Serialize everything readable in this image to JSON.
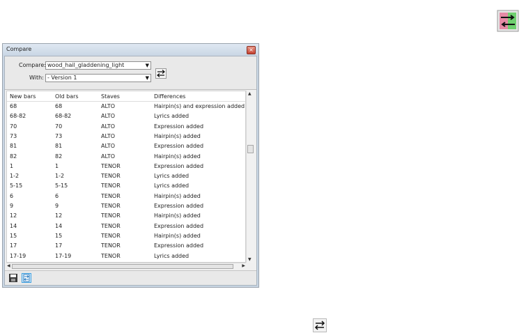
{
  "dialog": {
    "title": "Compare",
    "compare_label": "Compare:",
    "compare_value": "wood_hail_gladdening_light",
    "with_label": "With:",
    "with_value": "- Version 1"
  },
  "table": {
    "columns": [
      "New bars",
      "Old bars",
      "Staves",
      "Differences"
    ],
    "rows": [
      {
        "new": "68",
        "old": "68",
        "stave": "ALTO",
        "diff": "Hairpin(s) and expression added"
      },
      {
        "new": "68-82",
        "old": "68-82",
        "stave": "ALTO",
        "diff": "Lyrics added"
      },
      {
        "new": "70",
        "old": "70",
        "stave": "ALTO",
        "diff": "Expression added"
      },
      {
        "new": "73",
        "old": "73",
        "stave": "ALTO",
        "diff": "Hairpin(s) added"
      },
      {
        "new": "81",
        "old": "81",
        "stave": "ALTO",
        "diff": "Expression added"
      },
      {
        "new": "82",
        "old": "82",
        "stave": "ALTO",
        "diff": "Hairpin(s) added"
      },
      {
        "new": "1",
        "old": "1",
        "stave": "TENOR",
        "diff": "Expression added"
      },
      {
        "new": "1-2",
        "old": "1-2",
        "stave": "TENOR",
        "diff": "Lyrics added"
      },
      {
        "new": "5-15",
        "old": "5-15",
        "stave": "TENOR",
        "diff": "Lyrics added"
      },
      {
        "new": "6",
        "old": "6",
        "stave": "TENOR",
        "diff": "Hairpin(s) added"
      },
      {
        "new": "9",
        "old": "9",
        "stave": "TENOR",
        "diff": "Expression added"
      },
      {
        "new": "12",
        "old": "12",
        "stave": "TENOR",
        "diff": "Hairpin(s) added"
      },
      {
        "new": "14",
        "old": "14",
        "stave": "TENOR",
        "diff": "Expression added"
      },
      {
        "new": "15",
        "old": "15",
        "stave": "TENOR",
        "diff": "Hairpin(s) added"
      },
      {
        "new": "17",
        "old": "17",
        "stave": "TENOR",
        "diff": "Expression added"
      },
      {
        "new": "17-19",
        "old": "17-19",
        "stave": "TENOR",
        "diff": "Lyrics added"
      }
    ]
  },
  "icons": {
    "corner": "swap-panels-icon",
    "bottom": "swap-arrows-icon",
    "footer": [
      "save-icon",
      "compare-icon"
    ]
  },
  "colors": {
    "dialog_frame": "#c9d6e4",
    "close_button": "#c64231"
  }
}
